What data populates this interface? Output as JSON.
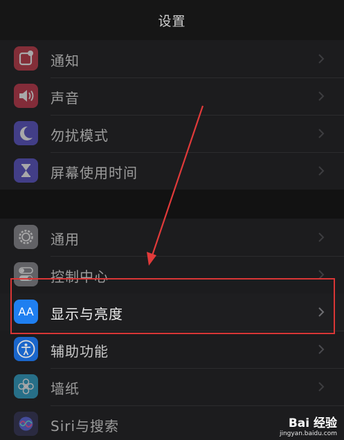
{
  "header": {
    "title": "设置"
  },
  "group1": [
    {
      "label": "通知",
      "icon": "notification-icon",
      "color": "#c23a48"
    },
    {
      "label": "声音",
      "icon": "speaker-icon",
      "color": "#c2364a"
    },
    {
      "label": "勿扰模式",
      "icon": "moon-icon",
      "color": "#5a54c8"
    },
    {
      "label": "屏幕使用时间",
      "icon": "hourglass-icon",
      "color": "#5a54c8"
    }
  ],
  "group2": [
    {
      "label": "通用",
      "icon": "gear-icon",
      "color": "#8e8e93"
    },
    {
      "label": "控制中心",
      "icon": "toggle-icon",
      "color": "#8e8e93"
    },
    {
      "label": "显示与亮度",
      "icon": "text-size-icon",
      "color": "#1f7ff0",
      "text": "AA"
    },
    {
      "label": "辅助功能",
      "icon": "accessibility-icon",
      "color": "#1a74ea"
    },
    {
      "label": "墙纸",
      "icon": "flower-icon",
      "color": "#2fa3c9"
    },
    {
      "label": "Siri与搜索",
      "icon": "siri-icon",
      "color": "#333355"
    }
  ],
  "annotation": {
    "color": "#d93636"
  },
  "watermark": {
    "brand": "Bai 经验",
    "url": "jingyan.baidu.com"
  }
}
